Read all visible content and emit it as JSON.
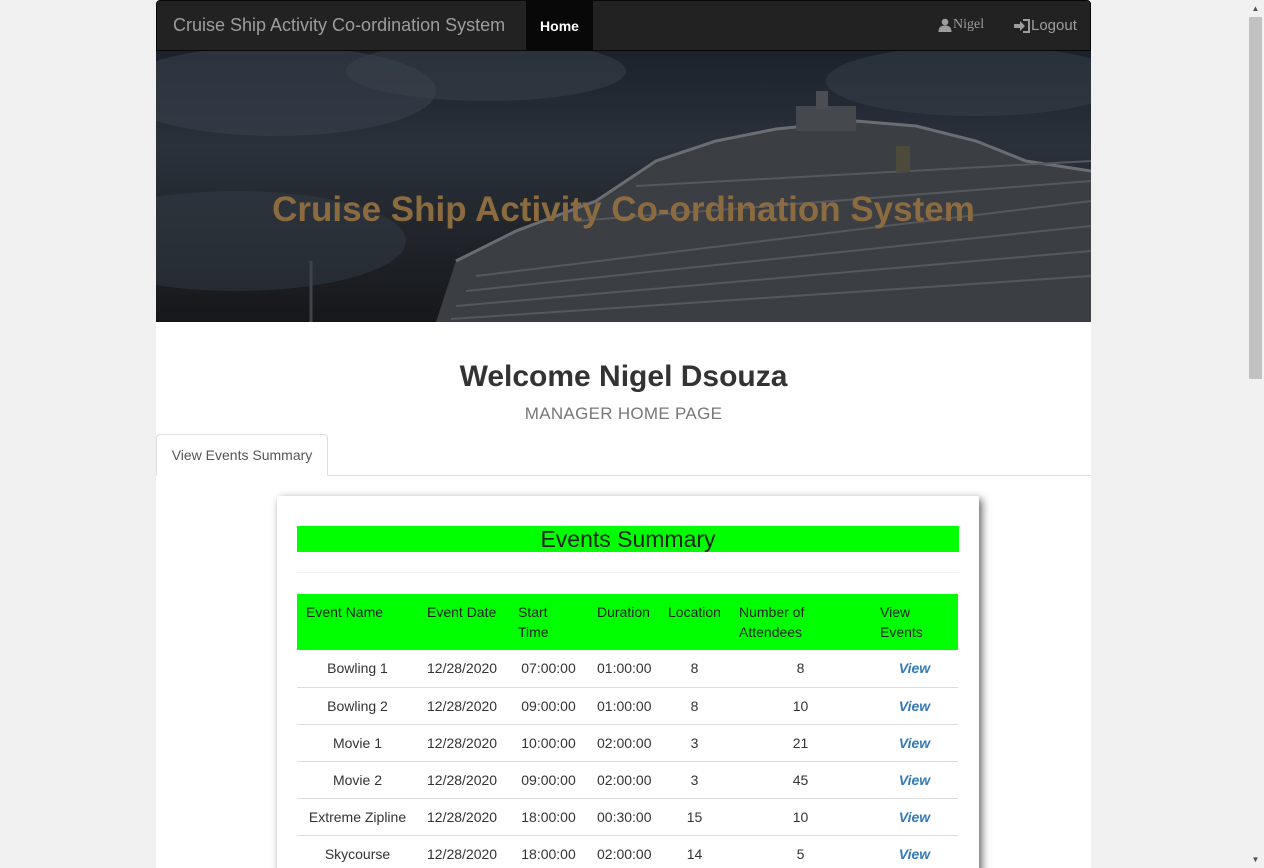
{
  "navbar": {
    "brand": "Cruise Ship Activity Co-ordination System",
    "home_label": "Home",
    "user_label": "Nigel",
    "logout_label": "Logout"
  },
  "hero": {
    "title": "Cruise Ship Activity Co-ordination System"
  },
  "page": {
    "welcome": "Welcome Nigel Dsouza",
    "subtitle": "MANAGER HOME PAGE",
    "tab_label": "View Events Summary"
  },
  "summary": {
    "heading": "Events Summary",
    "headers": [
      "Event Name",
      "Event Date",
      "Start Time",
      "Duration",
      "Location",
      "Number of Attendees",
      "View Events"
    ],
    "rows": [
      {
        "name": "Bowling 1",
        "date": "12/28/2020",
        "start": "07:00:00",
        "duration": "01:00:00",
        "location": "8",
        "attendees": "8",
        "view": "View"
      },
      {
        "name": "Bowling 2",
        "date": "12/28/2020",
        "start": "09:00:00",
        "duration": "01:00:00",
        "location": "8",
        "attendees": "10",
        "view": "View"
      },
      {
        "name": "Movie 1",
        "date": "12/28/2020",
        "start": "10:00:00",
        "duration": "02:00:00",
        "location": "3",
        "attendees": "21",
        "view": "View"
      },
      {
        "name": "Movie 2",
        "date": "12/28/2020",
        "start": "09:00:00",
        "duration": "02:00:00",
        "location": "3",
        "attendees": "45",
        "view": "View"
      },
      {
        "name": "Extreme Zipline",
        "date": "12/28/2020",
        "start": "18:00:00",
        "duration": "00:30:00",
        "location": "15",
        "attendees": "10",
        "view": "View"
      },
      {
        "name": "Skycourse",
        "date": "12/28/2020",
        "start": "18:00:00",
        "duration": "02:00:00",
        "location": "14",
        "attendees": "5",
        "view": "View"
      }
    ]
  },
  "colors": {
    "navbar_bg": "#222222",
    "summary_highlight": "#00ff00",
    "hero_title": "#8b6b3f",
    "link": "#337ab7"
  },
  "icons": {
    "user": "user-icon",
    "logout": "logout-icon"
  }
}
